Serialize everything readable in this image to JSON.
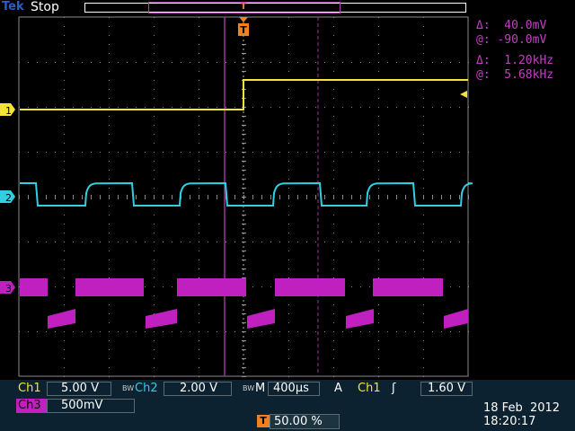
{
  "header": {
    "brand": "Tek",
    "state": "Stop",
    "trigger_marker": "T"
  },
  "channels": [
    {
      "id": "1",
      "label": "Ch1",
      "scale": "5.00 V",
      "color": "#f4e43a"
    },
    {
      "id": "2",
      "label": "Ch2",
      "scale": "2.00 V",
      "color": "#30d0e0"
    },
    {
      "id": "3",
      "label": "Ch3",
      "scale": "500mV",
      "color": "#c020c0"
    }
  ],
  "cursors": {
    "delta_voltage": "Δ:  40.0mV",
    "at_voltage": "@: -90.0mV",
    "delta_freq": "Δ:  1.20kHz",
    "at_freq": "@:  5.68kHz"
  },
  "bottom": {
    "ch1_label": "Ch1",
    "ch1_scale": "5.00 V",
    "bw_mark": "BW",
    "ch2_label": "Ch2",
    "ch2_scale": "2.00 V",
    "bw_mark2": "BW",
    "timebase_label": "M",
    "timebase": "400µs",
    "trigger_mode": "A",
    "trigger_source": "Ch1",
    "trigger_slope": "ʃ",
    "trigger_level": "1.60 V",
    "ch3_label": "Ch3",
    "ch3_scale": "500mV",
    "trigger_marker": "T",
    "trigger_position": "50.00 %",
    "date": "18 Feb  2012",
    "time": "18:20:17"
  },
  "colors": {
    "ch1": "#f4e43a",
    "ch2": "#30d0e0",
    "ch3": "#c020c0",
    "cursor": "#a030a0",
    "trigger": "#f08020",
    "grid": "#8a8a8a"
  }
}
